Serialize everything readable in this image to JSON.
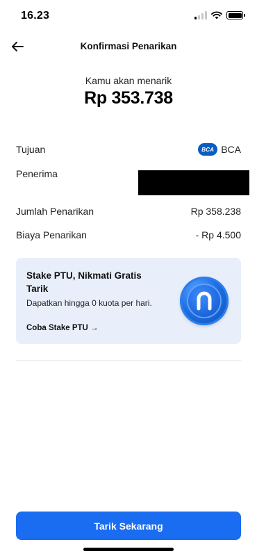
{
  "status_bar": {
    "time": "16.23"
  },
  "nav": {
    "title": "Konfirmasi Penarikan"
  },
  "amount": {
    "label": "Kamu akan menarik",
    "value": "Rp 353.738"
  },
  "details": {
    "tujuan_label": "Tujuan",
    "bank_logo_text": "BCA",
    "bank_name": "BCA",
    "penerima_label": "Penerima",
    "jumlah_label": "Jumlah Penarikan",
    "jumlah_value": "Rp 358.238",
    "biaya_label": "Biaya Penarikan",
    "biaya_value": "- Rp 4.500"
  },
  "promo": {
    "title": "Stake PTU, Nikmati Gratis Tarik",
    "description": "Dapatkan hingga 0 kuota per hari.",
    "link": "Coba Stake PTU →",
    "coin_icon": "ptu-coin-icon"
  },
  "cta": {
    "label": "Tarik Sekarang"
  },
  "colors": {
    "primary": "#1a6cf0",
    "promo_bg": "#e8effb",
    "bca_blue": "#0a5dc2"
  }
}
